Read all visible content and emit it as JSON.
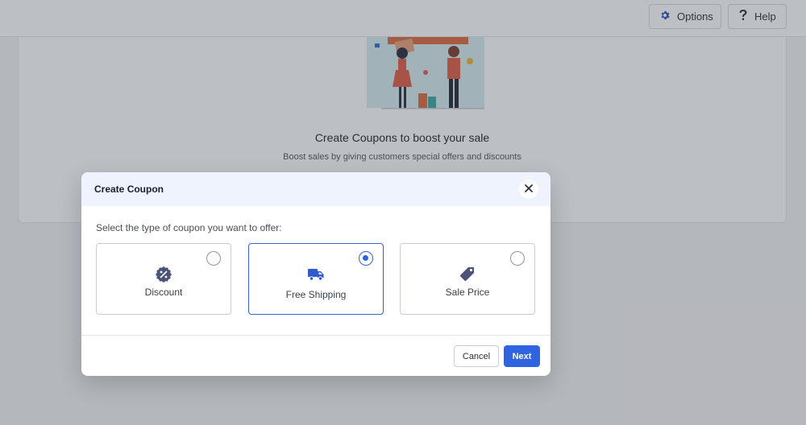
{
  "topbar": {
    "options_label": "Options",
    "help_label": "Help"
  },
  "background": {
    "title": "Create Coupons to boost your sale",
    "subtitle": "Boost sales by giving customers special offers and discounts"
  },
  "modal": {
    "title": "Create Coupon",
    "prompt": "Select the type of coupon you want to offer:",
    "options": [
      {
        "label": "Discount",
        "icon": "percent-badge-icon",
        "selected": false
      },
      {
        "label": "Free Shipping",
        "icon": "truck-icon",
        "selected": true
      },
      {
        "label": "Sale Price",
        "icon": "price-tag-icon",
        "selected": false
      }
    ],
    "cancel_label": "Cancel",
    "next_label": "Next"
  },
  "colors": {
    "accent": "#2f63e0",
    "header_bg": "#eef3fe",
    "icon": "#4a5478"
  }
}
